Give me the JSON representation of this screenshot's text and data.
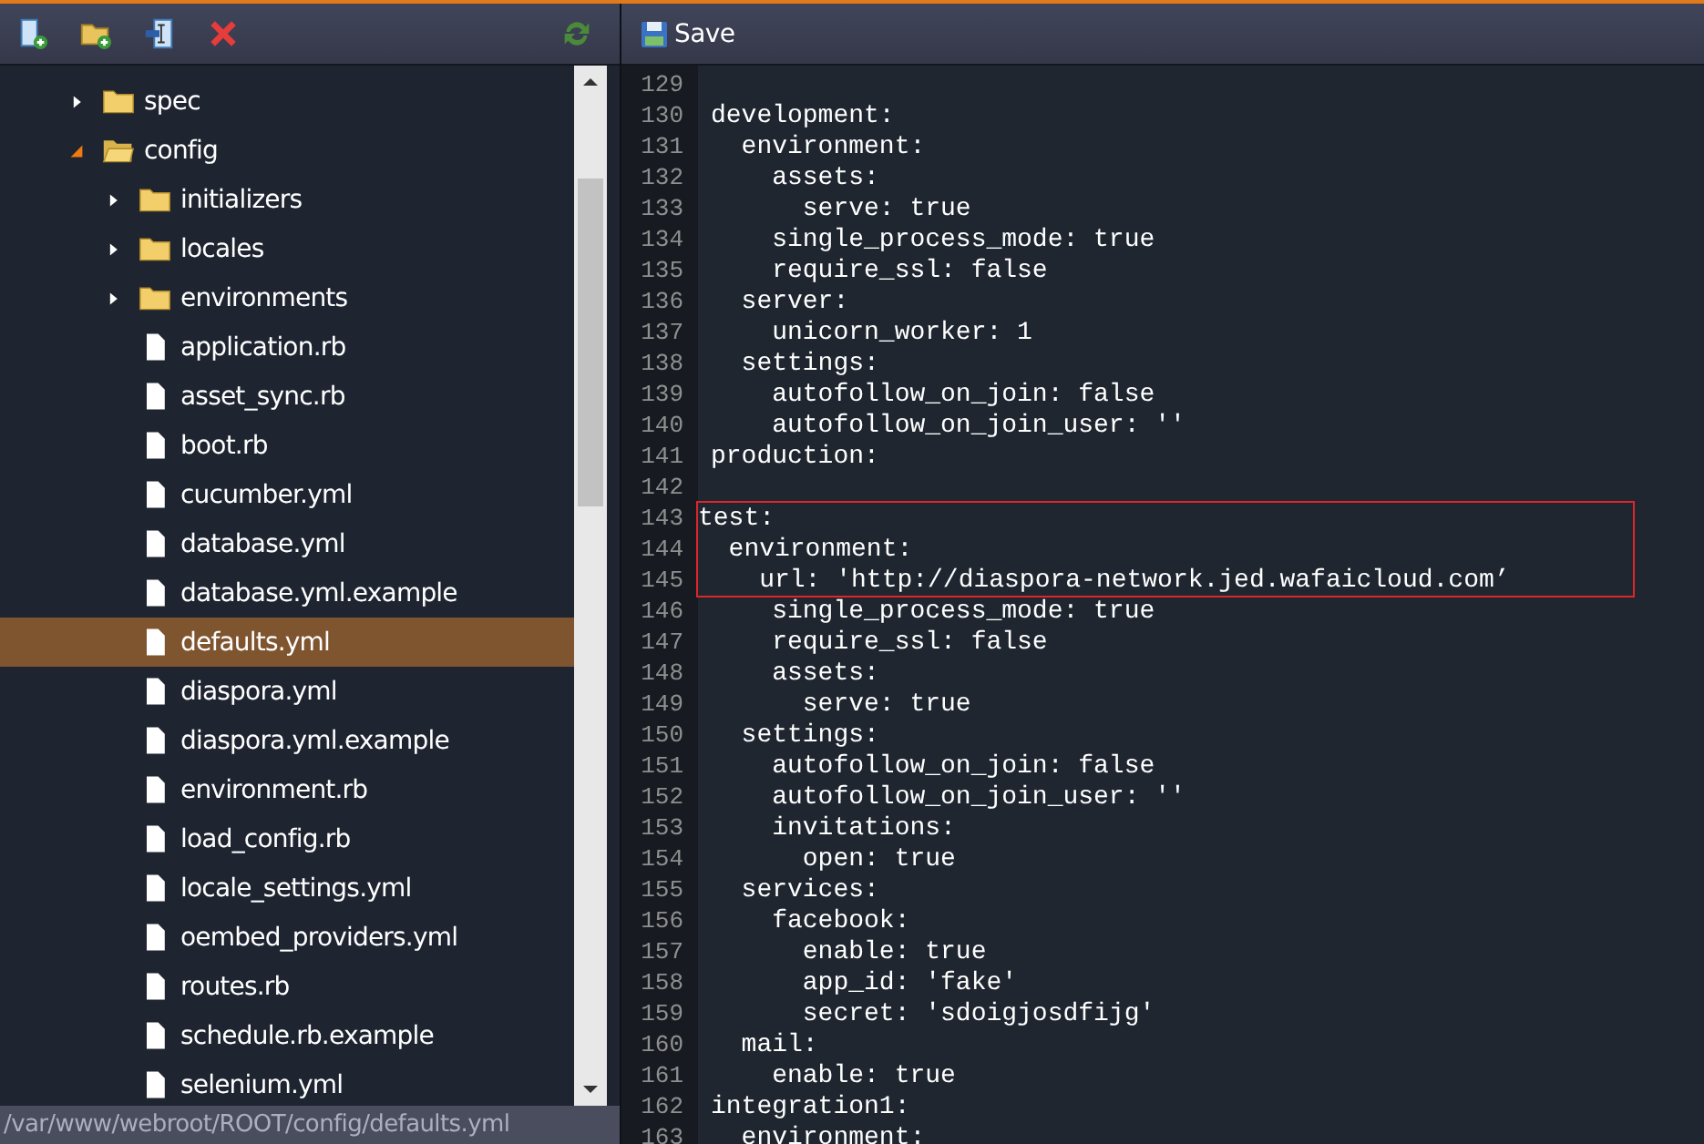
{
  "file_toolbar": {
    "buttons": [
      {
        "kind": "new-file"
      },
      {
        "kind": "new-folder"
      },
      {
        "kind": "rename"
      },
      {
        "kind": "delete"
      },
      {
        "kind": "refresh"
      }
    ]
  },
  "file_tree": [
    {
      "name": "spec",
      "kind": "folder",
      "expanded": false,
      "selected": false
    },
    {
      "name": "config",
      "kind": "folder",
      "expanded": true,
      "selected": false,
      "children": [
        {
          "name": "initializers",
          "kind": "folder",
          "expanded": false,
          "selected": false
        },
        {
          "name": "locales",
          "kind": "folder",
          "expanded": false,
          "selected": false
        },
        {
          "name": "environments",
          "kind": "folder",
          "expanded": false,
          "selected": false
        },
        {
          "name": "application.rb",
          "kind": "file",
          "selected": false
        },
        {
          "name": "asset_sync.rb",
          "kind": "file",
          "selected": false
        },
        {
          "name": "boot.rb",
          "kind": "file",
          "selected": false
        },
        {
          "name": "cucumber.yml",
          "kind": "file",
          "selected": false
        },
        {
          "name": "database.yml",
          "kind": "file",
          "selected": false
        },
        {
          "name": "database.yml.example",
          "kind": "file",
          "selected": false
        },
        {
          "name": "defaults.yml",
          "kind": "file",
          "selected": true
        },
        {
          "name": "diaspora.yml",
          "kind": "file",
          "selected": false
        },
        {
          "name": "diaspora.yml.example",
          "kind": "file",
          "selected": false
        },
        {
          "name": "environment.rb",
          "kind": "file",
          "selected": false
        },
        {
          "name": "load_config.rb",
          "kind": "file",
          "selected": false
        },
        {
          "name": "locale_settings.yml",
          "kind": "file",
          "selected": false
        },
        {
          "name": "oembed_providers.yml",
          "kind": "file",
          "selected": false
        },
        {
          "name": "routes.rb",
          "kind": "file",
          "selected": false
        },
        {
          "name": "schedule.rb.example",
          "kind": "file",
          "selected": false
        },
        {
          "name": "selenium.yml",
          "kind": "file",
          "selected": false
        }
      ]
    }
  ],
  "status_bar": {
    "path": "/var/www/webroot/ROOT/config/defaults.yml"
  },
  "editor_toolbar": {
    "save_label": "Save"
  },
  "code_lines": [
    {
      "number": "129",
      "highlighted": false
    },
    {
      "number": "130",
      "text": "development:",
      "highlighted": false
    },
    {
      "number": "131",
      "text": "  environment:",
      "highlighted": false
    },
    {
      "number": "132",
      "text": "    assets:",
      "highlighted": false
    },
    {
      "number": "133",
      "text": "      serve: true",
      "highlighted": false
    },
    {
      "number": "134",
      "text": "    single_process_mode: true",
      "highlighted": false
    },
    {
      "number": "135",
      "text": "    require_ssl: false",
      "highlighted": false
    },
    {
      "number": "136",
      "text": "  server:",
      "highlighted": false
    },
    {
      "number": "137",
      "text": "    unicorn_worker: 1",
      "highlighted": false
    },
    {
      "number": "138",
      "text": "  settings:",
      "highlighted": false
    },
    {
      "number": "139",
      "text": "    autofollow_on_join: false",
      "highlighted": false
    },
    {
      "number": "140",
      "text": "    autofollow_on_join_user: ''",
      "highlighted": false
    },
    {
      "number": "141",
      "text": "production:",
      "highlighted": false
    },
    {
      "number": "142",
      "highlighted": false
    },
    {
      "number": "143",
      "text": "test:",
      "highlighted": true
    },
    {
      "number": "144",
      "text": "  environment:",
      "highlighted": true
    },
    {
      "number": "145",
      "text": "    url: 'http://diaspora-network.jed.wafaicloud.com’",
      "highlighted": true
    },
    {
      "number": "146",
      "text": "    single_process_mode: true",
      "highlighted": false
    },
    {
      "number": "147",
      "text": "    require_ssl: false",
      "highlighted": false
    },
    {
      "number": "148",
      "text": "    assets:",
      "highlighted": false
    },
    {
      "number": "149",
      "text": "      serve: true",
      "highlighted": false
    },
    {
      "number": "150",
      "text": "  settings:",
      "highlighted": false
    },
    {
      "number": "151",
      "text": "    autofollow_on_join: false",
      "highlighted": false
    },
    {
      "number": "152",
      "text": "    autofollow_on_join_user: ''",
      "highlighted": false
    },
    {
      "number": "153",
      "text": "    invitations:",
      "highlighted": false
    },
    {
      "number": "154",
      "text": "      open: true",
      "highlighted": false
    },
    {
      "number": "155",
      "text": "  services:",
      "highlighted": false
    },
    {
      "number": "156",
      "text": "    facebook:",
      "highlighted": false
    },
    {
      "number": "157",
      "text": "      enable: true",
      "highlighted": false
    },
    {
      "number": "158",
      "text": "      app_id: 'fake'",
      "highlighted": false
    },
    {
      "number": "159",
      "text": "      secret: 'sdoigjosdfijg'",
      "highlighted": false
    },
    {
      "number": "160",
      "text": "  mail:",
      "highlighted": false
    },
    {
      "number": "161",
      "text": "    enable: true",
      "highlighted": false
    },
    {
      "number": "162",
      "text": "integration1:",
      "highlighted": false
    },
    {
      "number": "163",
      "text": "  environment:",
      "highlighted": false
    }
  ]
}
